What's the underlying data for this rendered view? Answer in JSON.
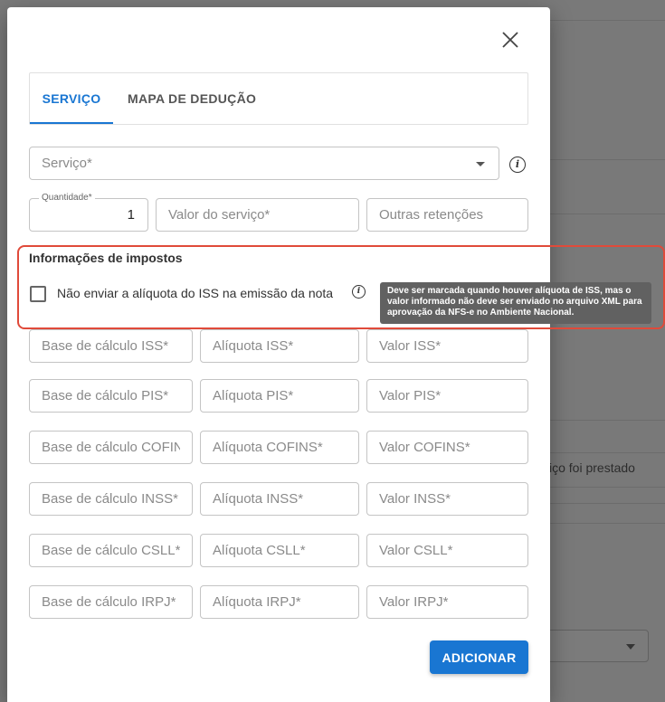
{
  "background": {
    "right_text": "viço foi prestado"
  },
  "tabs": [
    {
      "label": "SERVIÇO",
      "active": true
    },
    {
      "label": "MAPA DE DEDUÇÃO",
      "active": false
    }
  ],
  "form": {
    "service": {
      "placeholder": "Serviço*"
    },
    "quantity": {
      "label": "Quantidade*",
      "value": "1"
    },
    "service_value": {
      "placeholder": "Valor do serviço*"
    },
    "other_withholdings": {
      "placeholder": "Outras retenções"
    }
  },
  "taxes": {
    "title": "Informações de impostos",
    "checkbox_label": "Não enviar a alíquota do ISS na emissão da nota",
    "checkbox_checked": false,
    "tooltip": "Deve ser marcada quando houver alíquota de ISS, mas o valor informado não deve ser enviado no arquivo XML para aprovação da NFS-e no Ambiente Nacional.",
    "rows": [
      {
        "base": "Base de cálculo ISS*",
        "rate": "Alíquota ISS*",
        "value": "Valor ISS*"
      },
      {
        "base": "Base de cálculo PIS*",
        "rate": "Alíquota PIS*",
        "value": "Valor PIS*"
      },
      {
        "base": "Base de cálculo COFIN…",
        "rate": "Alíquota COFINS*",
        "value": "Valor COFINS*"
      },
      {
        "base": "Base de cálculo INSS*",
        "rate": "Alíquota INSS*",
        "value": "Valor INSS*"
      },
      {
        "base": "Base de cálculo CSLL*",
        "rate": "Alíquota CSLL*",
        "value": "Valor CSLL*"
      },
      {
        "base": "Base de cálculo IRPJ*",
        "rate": "Alíquota IRPJ*",
        "value": "Valor IRPJ*"
      }
    ]
  },
  "actions": {
    "add_label": "ADICIONAR"
  },
  "colors": {
    "accent": "#1976d2",
    "highlight": "#e04a3a",
    "tooltip_bg": "#616161"
  }
}
